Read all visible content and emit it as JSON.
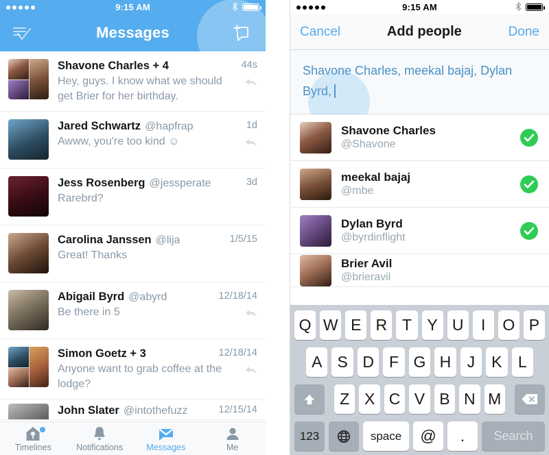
{
  "colors": {
    "brand_blue": "#55acee",
    "link_blue": "#5aa9e6",
    "check_green": "#2ecc55",
    "muted_gray": "#8899a6",
    "keyboard_bg": "#c9cfd6"
  },
  "left_phone": {
    "status_bar": {
      "time": "9:15 AM",
      "signal_dots": 5,
      "bluetooth_icon": "bluetooth-icon",
      "battery_icon": "battery-icon"
    },
    "nav": {
      "title": "Messages",
      "left_icon": "list-check-icon",
      "right_icon": "compose-message-icon"
    },
    "conversations": [
      {
        "name": "Shavone Charles + 4",
        "handle": "",
        "preview": "Hey, guys. I know what we should get Brier for her birthday.",
        "time": "44s",
        "avatar_type": "group",
        "has_reply_arrow": true
      },
      {
        "name": "Jared Schwartz",
        "handle": "@hapfrap",
        "preview": "Awww, you're too kind ☺",
        "time": "1d",
        "avatar_type": "single",
        "has_reply_arrow": true
      },
      {
        "name": "Jess Rosenberg",
        "handle": "@jessperate",
        "preview": "Rarebrd?",
        "time": "3d",
        "avatar_type": "single",
        "has_reply_arrow": false
      },
      {
        "name": "Carolina Janssen",
        "handle": "@lija",
        "preview": "Great! Thanks",
        "time": "1/5/15",
        "avatar_type": "single",
        "has_reply_arrow": false
      },
      {
        "name": "Abigail Byrd",
        "handle": "@abyrd",
        "preview": "Be there in 5",
        "time": "12/18/14",
        "avatar_type": "single",
        "has_reply_arrow": true
      },
      {
        "name": "Simon Goetz + 3",
        "handle": "",
        "preview": "Anyone want to grab coffee at the lodge?",
        "time": "12/18/14",
        "avatar_type": "group",
        "has_reply_arrow": true
      },
      {
        "name": "John Slater",
        "handle": "@intothefuzz",
        "preview": "",
        "time": "12/15/14",
        "avatar_type": "single",
        "has_reply_arrow": false
      }
    ],
    "tabs": [
      {
        "label": "Timelines",
        "icon": "birdhouse-icon",
        "active": false,
        "badge": true
      },
      {
        "label": "Notifications",
        "icon": "bell-icon",
        "active": false,
        "badge": false
      },
      {
        "label": "Messages",
        "icon": "envelope-icon",
        "active": true,
        "badge": false
      },
      {
        "label": "Me",
        "icon": "person-icon",
        "active": false,
        "badge": false
      }
    ]
  },
  "right_phone": {
    "status_bar": {
      "time": "9:15 AM",
      "signal_dots": 5,
      "bluetooth_icon": "bluetooth-icon",
      "battery_icon": "battery-icon"
    },
    "nav": {
      "cancel_label": "Cancel",
      "title": "Add people",
      "done_label": "Done"
    },
    "to_field": {
      "value": "Shavone Charles, meekal bajaj, Dylan Byrd,",
      "caret_visible": true
    },
    "people": [
      {
        "name": "Shavone Charles",
        "handle": "@Shavone",
        "selected": true
      },
      {
        "name": "meekal bajaj",
        "handle": "@mbe",
        "selected": true
      },
      {
        "name": "Dylan Byrd",
        "handle": "@byrdinflight",
        "selected": true
      },
      {
        "name": "Brier Avil",
        "handle": "@brieravil",
        "selected": false
      }
    ],
    "keyboard": {
      "row1": [
        "Q",
        "W",
        "E",
        "R",
        "T",
        "Y",
        "U",
        "I",
        "O",
        "P"
      ],
      "row2": [
        "A",
        "S",
        "D",
        "F",
        "G",
        "H",
        "J",
        "K",
        "L"
      ],
      "row3_letters": [
        "Z",
        "X",
        "C",
        "V",
        "B",
        "N",
        "M"
      ],
      "shift_icon": "shift-arrow-icon",
      "delete_icon": "backspace-icon",
      "numbers_label": "123",
      "globe_icon": "globe-icon",
      "space_label": "space",
      "at_label": "@",
      "dot_label": ".",
      "search_label": "Search"
    }
  }
}
